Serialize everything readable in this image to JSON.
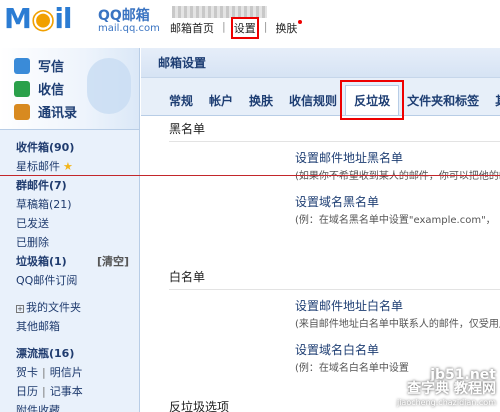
{
  "header": {
    "logo_text": "M",
    "logo_dot": "◉",
    "logo_tail": "il",
    "brand_name": "QQ邮箱",
    "brand_url": "mail.qq.com",
    "nav": [
      "邮箱首页",
      "设置",
      "换肤"
    ]
  },
  "sidebar": {
    "quick": [
      {
        "label": "写信",
        "icon": "pencil-icon"
      },
      {
        "label": "收信",
        "icon": "inbox-arrow-icon"
      },
      {
        "label": "通讯录",
        "icon": "address-book-icon"
      }
    ],
    "inbox": "收件箱(90)",
    "starred": "星标邮件",
    "group": "群邮件(7)",
    "drafts": "草稿箱(21)",
    "sent": "已发送",
    "deleted": "已删除",
    "spam": "垃圾箱(1)",
    "spam_clear": "[清空]",
    "subscribe": "QQ邮件订阅",
    "my_folders": "我的文件夹",
    "other_mailbox": "其他邮箱",
    "drift_bottle": "漂流瓶(16)",
    "card": "贺卡",
    "postcard": "明信片",
    "calendar": "日历",
    "notebook": "记事本",
    "attachments": "附件收藏"
  },
  "main": {
    "title": "邮箱设置",
    "tabs": [
      "常规",
      "帐户",
      "换肤",
      "收信规则",
      "反垃圾",
      "文件夹和标签",
      "其"
    ],
    "blacklist": {
      "title": "黑名单",
      "link1": "设置邮件地址黑名单",
      "desc1": "(如果你不希望收到某人的邮件，你可以把他的邮",
      "link2": "设置域名黑名单",
      "desc2": "(例：在域名黑名单中设置\"example.com\"，"
    },
    "whitelist": {
      "title": "白名单",
      "link1": "设置邮件地址白名单",
      "desc1": "(来自邮件地址白名单中联系人的邮件，仅受用户",
      "link2": "设置域名白名单",
      "desc2": "(例：在域名白名单中设置"
    },
    "antispam_options": "反垃圾选项"
  },
  "watermark": {
    "line1": "查字典 教程网",
    "line2": "jiaocheng.chazidian.com",
    "site": "jb51.net"
  },
  "colors": {
    "accent": "#2b7cd3",
    "highlight_box": "#ee0000",
    "sidebar_bg": "#e9f1fb"
  }
}
